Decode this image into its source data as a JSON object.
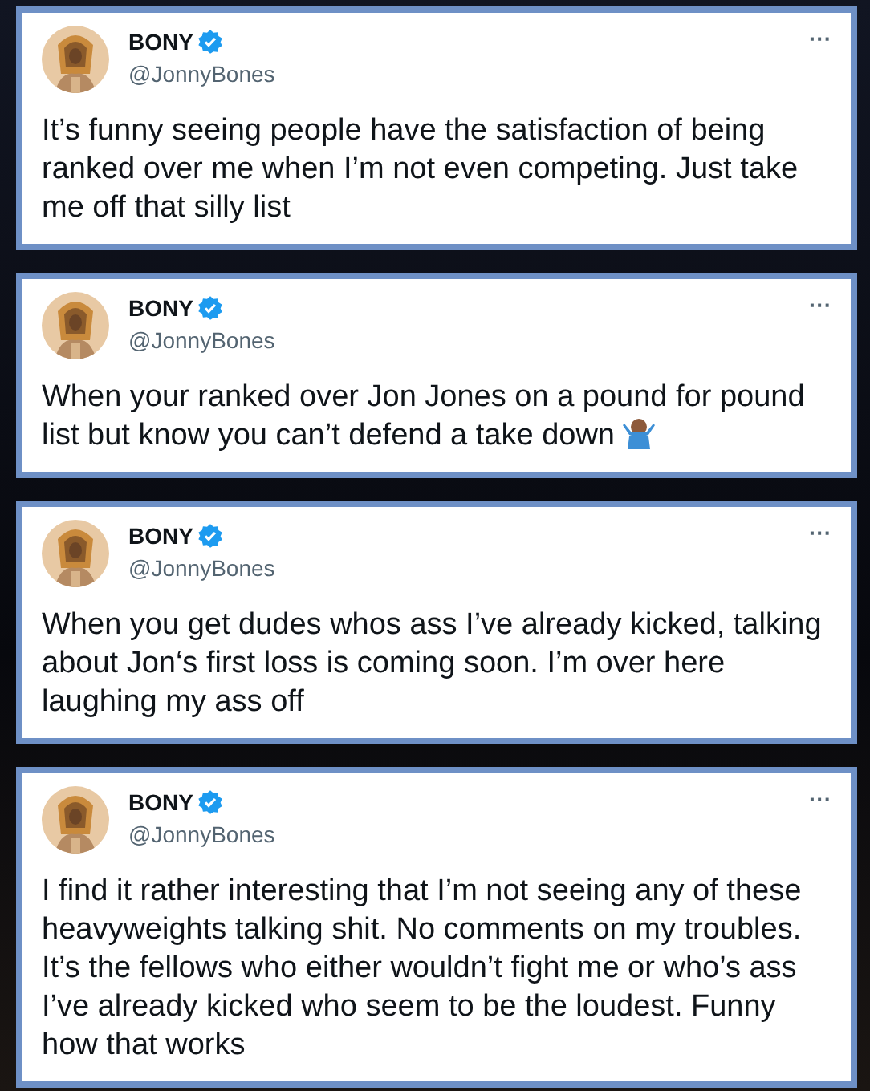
{
  "tweets": [
    {
      "name": "BONY",
      "verified": true,
      "handle": "@JonnyBones",
      "text": "It’s funny seeing people have the satisfaction of being ranked over me when I’m not even competing. Just take me off that silly list",
      "more": "···",
      "shrug": false
    },
    {
      "name": "BONY",
      "verified": true,
      "handle": "@JonnyBones",
      "text": "When your ranked over Jon Jones on a pound for pound list but know you can’t defend a take down",
      "more": "···",
      "shrug": true
    },
    {
      "name": "BONY",
      "verified": true,
      "handle": "@JonnyBones",
      "text": "When you get dudes whos ass I’ve already kicked, talking about Jon‘s first loss is coming soon. I’m over here laughing my ass off",
      "more": "···",
      "shrug": false
    },
    {
      "name": "BONY",
      "verified": true,
      "handle": "@JonnyBones",
      "text": "I find it rather interesting that I’m not seeing any of these heavyweights talking shit. No comments on my troubles. It’s the fellows who either wouldn’t fight me or who’s ass I’ve already kicked who seem to be the loudest. Funny how that works",
      "more": "···",
      "shrug": false
    }
  ]
}
